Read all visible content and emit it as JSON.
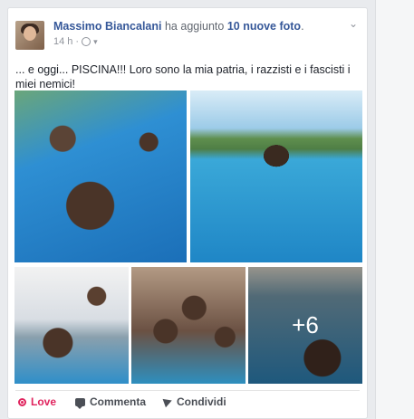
{
  "post": {
    "author": "Massimo Biancalani",
    "action_prefix": "ha aggiunto",
    "photo_count_text": "10 nuove foto",
    "action_suffix": ".",
    "time": "14 h",
    "separator": "·",
    "privacy_icon": "globe-icon",
    "text": "... e oggi... PISCINA!!! Loro sono la mia patria, i razzisti e i fascisti i miei nemici!",
    "more_photos": "+6"
  },
  "actions": {
    "love_label": "Love",
    "comment_label": "Commenta",
    "share_label": "Condividi"
  },
  "colors": {
    "link": "#365899",
    "love": "#e0245e",
    "meta": "#90949c"
  }
}
